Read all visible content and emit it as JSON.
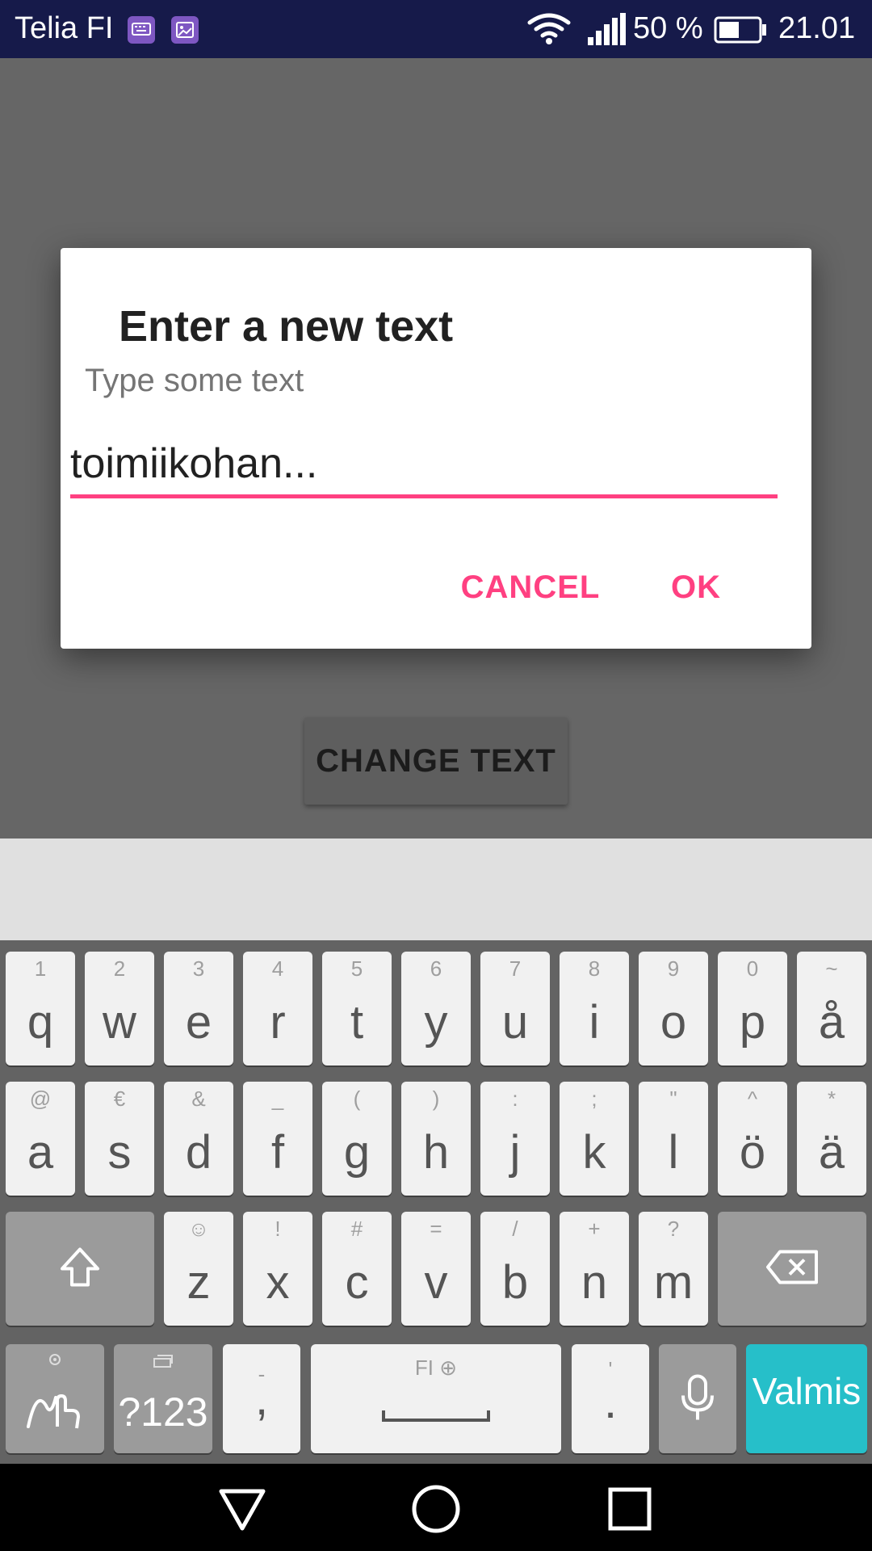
{
  "status_bar": {
    "carrier": "Telia FI",
    "battery_percent": "50 %",
    "time": "21.01",
    "icons": [
      "keyboard-notification-icon",
      "image-notification-icon",
      "wifi-icon",
      "signal-icon",
      "battery-icon"
    ]
  },
  "dialog": {
    "title": "Enter a new text",
    "message": "Type some text",
    "input_value": "toimiikohan...",
    "cancel_label": "CANCEL",
    "ok_label": "OK",
    "accent_color": "#ff4081"
  },
  "app": {
    "change_text_label": "CHANGE TEXT"
  },
  "keyboard": {
    "row1": [
      {
        "key": "q",
        "hint": "1"
      },
      {
        "key": "w",
        "hint": "2"
      },
      {
        "key": "e",
        "hint": "3"
      },
      {
        "key": "r",
        "hint": "4"
      },
      {
        "key": "t",
        "hint": "5"
      },
      {
        "key": "y",
        "hint": "6"
      },
      {
        "key": "u",
        "hint": "7"
      },
      {
        "key": "i",
        "hint": "8"
      },
      {
        "key": "o",
        "hint": "9"
      },
      {
        "key": "p",
        "hint": "0"
      },
      {
        "key": "å",
        "hint": "~"
      }
    ],
    "row2": [
      {
        "key": "a",
        "hint": "@"
      },
      {
        "key": "s",
        "hint": "€"
      },
      {
        "key": "d",
        "hint": "&"
      },
      {
        "key": "f",
        "hint": "_"
      },
      {
        "key": "g",
        "hint": "("
      },
      {
        "key": "h",
        "hint": ")"
      },
      {
        "key": "j",
        "hint": ":"
      },
      {
        "key": "k",
        "hint": ";"
      },
      {
        "key": "l",
        "hint": "\""
      },
      {
        "key": "ö",
        "hint": "^"
      },
      {
        "key": "ä",
        "hint": "*"
      }
    ],
    "row3": [
      {
        "key": "z",
        "hint": "☺"
      },
      {
        "key": "x",
        "hint": "!"
      },
      {
        "key": "c",
        "hint": "#"
      },
      {
        "key": "v",
        "hint": "="
      },
      {
        "key": "b",
        "hint": "/"
      },
      {
        "key": "n",
        "hint": "+"
      },
      {
        "key": "m",
        "hint": "?"
      }
    ],
    "symbols_label": "?123",
    "comma_label": ",",
    "comma_hint": "-",
    "space_hint": "FI",
    "period_label": ".",
    "period_hint": "'",
    "done_label": "Valmis",
    "done_color": "#26bfc9"
  },
  "nav_bar": {
    "icons": [
      "back-icon",
      "home-icon",
      "recents-icon"
    ]
  }
}
